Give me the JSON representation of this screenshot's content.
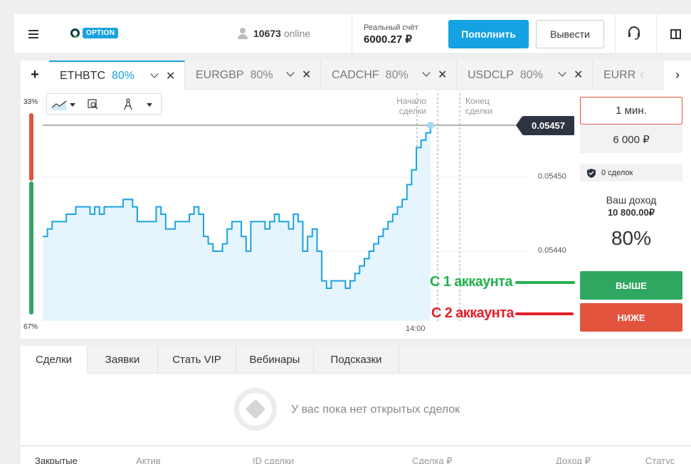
{
  "header": {
    "logo_text": "OPTION",
    "online_count": "10673",
    "online_label": "online",
    "balance_label": "Реальный счёт",
    "balance_value": "6000.27 ₽",
    "deposit_label": "Пополнить",
    "withdraw_label": "Вывести"
  },
  "tabs": [
    {
      "name": "ETHBTC",
      "pct": "80%"
    },
    {
      "name": "EURGBP",
      "pct": "80%"
    },
    {
      "name": "CADCHF",
      "pct": "80%"
    },
    {
      "name": "USDCLP",
      "pct": "80%"
    },
    {
      "name": "EURR",
      "pct": ""
    }
  ],
  "chart": {
    "sentiment_up_pct": "33%",
    "sentiment_down_pct": "67%",
    "start_label": "Начало сделки",
    "end_label": "Конец сделки",
    "current_price": "0.05457",
    "y_ticks": [
      "0.05450",
      "0.05440"
    ],
    "x_tick": "14:00"
  },
  "chart_data": {
    "type": "area",
    "title": "",
    "xlabel": "",
    "ylabel": "",
    "x_ticks": [
      "14:00"
    ],
    "y_ticks": [
      0.0545,
      0.0544
    ],
    "ylim": [
      0.05433,
      0.05462
    ],
    "current_value": 0.05457,
    "series": [
      {
        "values": [
          0.05442,
          0.05443,
          0.05444,
          0.05444,
          0.05444,
          0.05445,
          0.05445,
          0.05446,
          0.05446,
          0.05446,
          0.05445,
          0.05446,
          0.05445,
          0.05446,
          0.05446,
          0.05446,
          0.05446,
          0.05447,
          0.05447,
          0.05446,
          0.05444,
          0.05444,
          0.05444,
          0.05444,
          0.05446,
          0.05445,
          0.05443,
          0.05443,
          0.05444,
          0.05444,
          0.05444,
          0.05445,
          0.05446,
          0.05445,
          0.05442,
          0.05441,
          0.0544,
          0.0544,
          0.05441,
          0.05443,
          0.05444,
          0.05444,
          0.05442,
          0.0544,
          0.05444,
          0.05444,
          0.05444,
          0.05443,
          0.05444,
          0.05445,
          0.05444,
          0.05444,
          0.05443,
          0.05445,
          0.05444,
          0.0544,
          0.05442,
          0.05443,
          0.0544,
          0.05436,
          0.05435,
          0.05436,
          0.05436,
          0.05436,
          0.05435,
          0.05436,
          0.05437,
          0.05438,
          0.05439,
          0.0544,
          0.05441,
          0.05442,
          0.05443,
          0.05444,
          0.05445,
          0.05446,
          0.05447,
          0.05449,
          0.05451,
          0.05454,
          0.05455,
          0.05456,
          0.05457
        ]
      }
    ]
  },
  "trade": {
    "duration": "1 мин.",
    "amount": "6 000 ₽",
    "deals": "0 сделок",
    "income_label": "Ваш доход",
    "income_value": "10 800.00₽",
    "payout_pct": "80%",
    "up_label": "ВЫШЕ",
    "down_label": "НИЖЕ"
  },
  "annotations": {
    "first": "С 1 аккаунта",
    "second": "С 2 аккаунта",
    "first_color": "#22b14c",
    "second_color": "#e3202a"
  },
  "bottom": {
    "tabs": [
      "Сделки",
      "Заявки",
      "Стать VIP",
      "Вебинары",
      "Подсказки"
    ],
    "empty_text": "У вас пока нет открытых сделок",
    "columns": [
      "Закрытые",
      "Актив",
      "ID сделки",
      "Сделка ₽",
      "Доход ₽",
      "Статус"
    ]
  },
  "colors": {
    "accent": "#1aa3e0",
    "up": "#2fa760",
    "down": "#e2543e",
    "price_tag": "#2d3442"
  }
}
